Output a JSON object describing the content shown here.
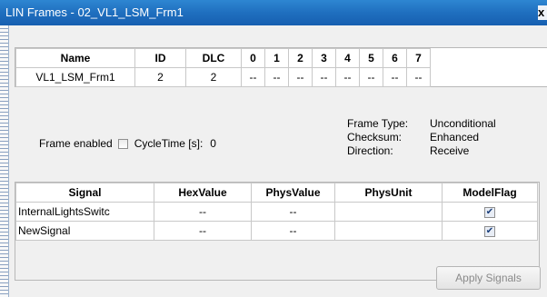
{
  "window": {
    "title": "LIN Frames - 02_VL1_LSM_Frm1",
    "close_glyph": "x"
  },
  "frames_table": {
    "headers": [
      "Name",
      "ID",
      "DLC",
      "0",
      "1",
      "2",
      "3",
      "4",
      "5",
      "6",
      "7"
    ],
    "rows": [
      [
        "VL1_LSM_Frm1",
        "2",
        "2",
        "--",
        "--",
        "--",
        "--",
        "--",
        "--",
        "--",
        "--"
      ]
    ]
  },
  "frame_enabled": {
    "label": "Frame enabled",
    "checked": false
  },
  "cycle_time": {
    "label": "CycleTime [s]:",
    "value": "0"
  },
  "frame_info": {
    "labels": [
      "Frame Type:",
      "Checksum:",
      "Direction:"
    ],
    "values": [
      "Unconditional",
      "Enhanced",
      "Receive"
    ]
  },
  "signals_table": {
    "headers": [
      "Signal",
      "HexValue",
      "PhysValue",
      "PhysUnit",
      "ModelFlag"
    ],
    "rows": [
      {
        "signal": "InternalLightsSwitc",
        "hex": "--",
        "phys": "--",
        "unit": "",
        "model_flag": true
      },
      {
        "signal": "NewSignal",
        "hex": "--",
        "phys": "--",
        "unit": "",
        "model_flag": true
      }
    ]
  },
  "apply_button": {
    "label": "Apply Signals",
    "enabled": false
  },
  "colors": {
    "title_bar": "#1f6fbf",
    "disabled_text": "#8a8a8a"
  }
}
